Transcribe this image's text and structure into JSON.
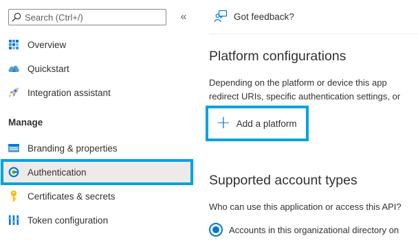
{
  "sidebar": {
    "search": {
      "placeholder": "Search (Ctrl+/)"
    },
    "collapse_glyph": "«",
    "items_top": [
      {
        "label": "Overview",
        "icon": "overview-grid-icon"
      },
      {
        "label": "Quickstart",
        "icon": "quickstart-cloud-icon"
      },
      {
        "label": "Integration assistant",
        "icon": "rocket-icon"
      }
    ],
    "section_manage": "Manage",
    "items_manage": [
      {
        "label": "Branding & properties",
        "icon": "branding-icon"
      },
      {
        "label": "Authentication",
        "icon": "authentication-icon",
        "selected": true
      },
      {
        "label": "Certificates & secrets",
        "icon": "key-icon"
      },
      {
        "label": "Token configuration",
        "icon": "token-bars-icon"
      }
    ]
  },
  "toolbar": {
    "feedback_label": "Got feedback?"
  },
  "main": {
    "platform_title": "Platform configurations",
    "platform_desc_line1": "Depending on the platform or device this app",
    "platform_desc_line2": "redirect URIs, specific authentication settings, or",
    "add_platform_label": "Add a platform",
    "account_types_title": "Supported account types",
    "account_question": "Who can use this application or access this API?",
    "radio_option_1": "Accounts in this organizational directory on"
  },
  "colors": {
    "highlight": "#00a3e0",
    "accent": "#0078d4",
    "selected_bg": "#edebe9"
  }
}
